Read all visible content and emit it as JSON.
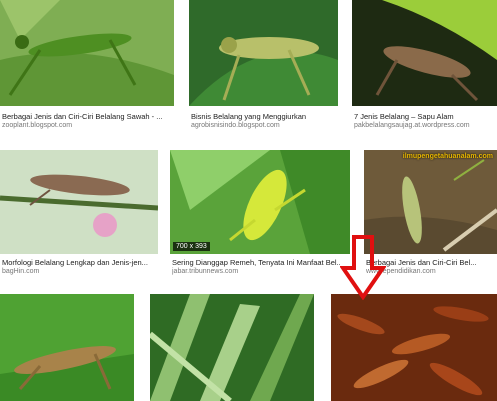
{
  "results": [
    {
      "title": "Berbagai Jenis dan Ciri-Ciri Belalang Sawah - ...",
      "source": "zooplant.blogspot.com"
    },
    {
      "title": "Bisnis Belalang yang Menggiurkan",
      "source": "agrobisnisindo.blogspot.com"
    },
    {
      "title": "7 Jenis Belalang – Sapu Alam",
      "source": "pakbelalangsaujag.at.wordpress.com"
    },
    {
      "title": "Morfologi Belalang Lengkap dan Jenis-jen...",
      "source": "bagHin.com"
    },
    {
      "title": "Sering Dianggap Remeh, Tenyata Ini Manfaat Bel...",
      "source": "jabar.tribunnews.com",
      "dimensions": "700 x 393"
    },
    {
      "title": "Berbagai Jenis dan Ciri-Ciri Bel...",
      "source": "www.ependidikan.com",
      "watermark": "ilmupengetahuanalam.com"
    }
  ],
  "colors": {
    "arrow": "#e01010",
    "caption_title": "#222222",
    "caption_source": "#777777"
  }
}
